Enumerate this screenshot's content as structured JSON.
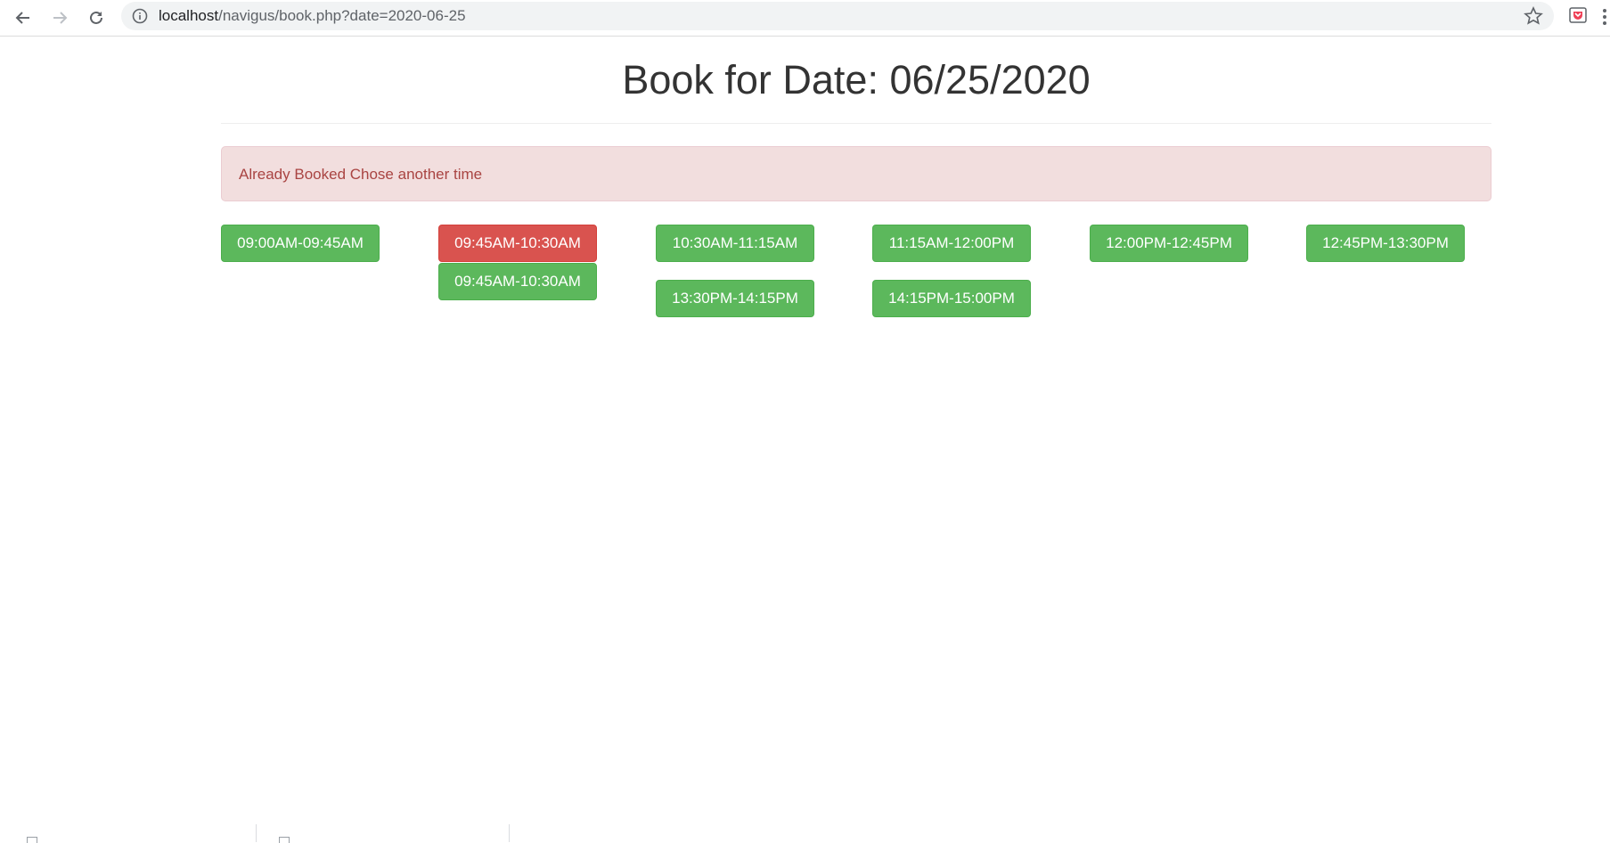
{
  "browser": {
    "url_host": "localhost",
    "url_path": "/navigus/book.php?date=2020-06-25"
  },
  "page": {
    "title": "Book for Date: 06/25/2020",
    "alert": "Already Booked Chose another time"
  },
  "slots": [
    {
      "label": "09:00AM-09:45AM",
      "status": "available"
    },
    {
      "label": "09:45AM-10:30AM",
      "status": "booked"
    },
    {
      "label": "09:45AM-10:30AM",
      "status": "available"
    },
    {
      "label": "10:30AM-11:15AM",
      "status": "available"
    },
    {
      "label": "13:30PM-14:15PM",
      "status": "available"
    },
    {
      "label": "11:15AM-12:00PM",
      "status": "available"
    },
    {
      "label": "14:15PM-15:00PM",
      "status": "available"
    },
    {
      "label": "12:00PM-12:45PM",
      "status": "available"
    },
    {
      "label": "12:45PM-13:30PM",
      "status": "available"
    }
  ],
  "colors": {
    "available": "#5cb85c",
    "booked": "#d9534f",
    "alert_bg": "#f2dede",
    "alert_text": "#a94442"
  }
}
